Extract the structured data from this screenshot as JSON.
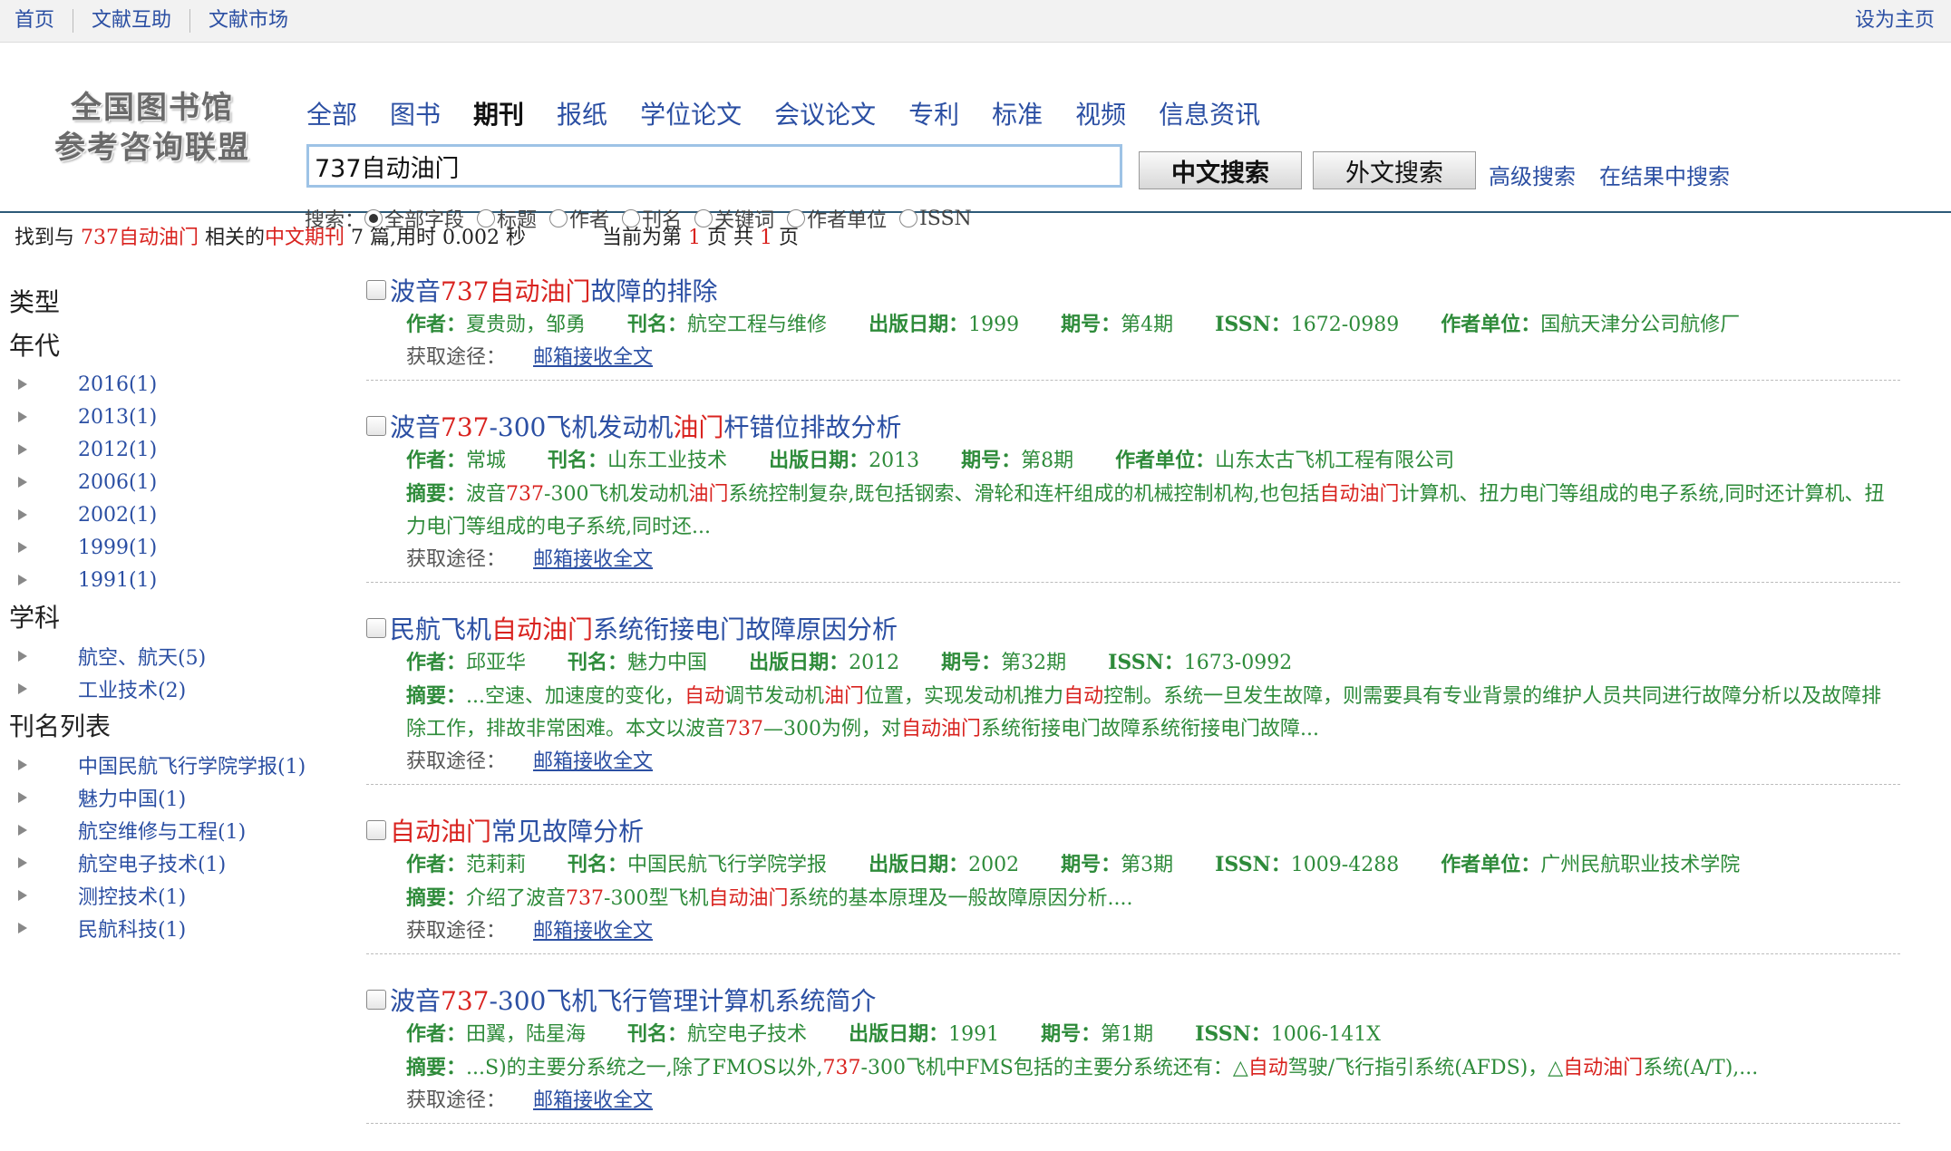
{
  "topbar": {
    "links": [
      "首页",
      "文献互助",
      "文献市场"
    ],
    "right": "设为主页"
  },
  "logo": {
    "line1": "全国图书馆",
    "line2": "参考咨询联盟"
  },
  "categories": [
    {
      "label": "全部",
      "active": false
    },
    {
      "label": "图书",
      "active": false
    },
    {
      "label": "期刊",
      "active": true
    },
    {
      "label": "报纸",
      "active": false
    },
    {
      "label": "学位论文",
      "active": false
    },
    {
      "label": "会议论文",
      "active": false
    },
    {
      "label": "专利",
      "active": false
    },
    {
      "label": "标准",
      "active": false
    },
    {
      "label": "视频",
      "active": false
    },
    {
      "label": "信息资讯",
      "active": false
    }
  ],
  "search": {
    "value": "737自动油门",
    "cn_button": "中文搜索",
    "foreign_button": "外文搜索",
    "advanced": "高级搜索",
    "within": "在结果中搜索"
  },
  "scope": {
    "label": "搜索：",
    "options": [
      "全部字段",
      "标题",
      "作者",
      "刊名",
      "关键词",
      "作者单位",
      "ISSN"
    ],
    "selected": 0
  },
  "summary": {
    "p1": "找到与 ",
    "keyword": "737自动油门",
    "p2": " 相关的",
    "type": "中文期刊",
    "p3": " 7 篇,用时 0.002 秒",
    "p4": "当前为第 ",
    "cur": "1",
    "p5": " 页 共 ",
    "total": "1",
    "p6": " 页"
  },
  "sidebar": {
    "type_heading": "类型",
    "year_heading": "年代",
    "years": [
      "2016(1)",
      "2013(1)",
      "2012(1)",
      "2006(1)",
      "2002(1)",
      "1999(1)",
      "1991(1)"
    ],
    "subject_heading": "学科",
    "subjects": [
      "航空、航天(5)",
      "工业技术(2)"
    ],
    "journal_heading": "刊名列表",
    "journals": [
      "中国民航飞行学院学报(1)",
      "魅力中国(1)",
      "航空维修与工程(1)",
      "航空电子技术(1)",
      "测控技术(1)",
      "民航科技(1)"
    ]
  },
  "labels": {
    "author": "作者：",
    "journal": "刊名：",
    "date": "出版日期：",
    "issue": "期号：",
    "issn": "ISSN：",
    "unit": "作者单位：",
    "abstract": "摘要：",
    "get": "获取途径：",
    "mail": "邮箱接收全文"
  },
  "results": [
    {
      "title": [
        [
          "波音",
          0
        ],
        [
          "737自动油门",
          1
        ],
        [
          "故障的排除",
          0
        ]
      ],
      "author": "夏贵勋，邹勇",
      "journal": "航空工程与维修",
      "date": "1999",
      "issue": "第4期",
      "issn": "1672-0989",
      "unit": "国航天津分公司航修厂",
      "abstract": null
    },
    {
      "title": [
        [
          "波音",
          0
        ],
        [
          "737",
          1
        ],
        [
          "-300飞机发动机",
          0
        ],
        [
          "油门",
          1
        ],
        [
          "杆错位排故分析",
          0
        ]
      ],
      "author": "常城",
      "journal": "山东工业技术",
      "date": "2013",
      "issue": "第8期",
      "issn": null,
      "unit": "山东太古飞机工程有限公司",
      "abstract": [
        [
          "波音",
          0
        ],
        [
          "737",
          1
        ],
        [
          "-300飞机发动机",
          0
        ],
        [
          "油门",
          1
        ],
        [
          "系统控制复杂,既包括钢索、滑轮和连杆组成的机械控制机构,也包括",
          0
        ],
        [
          "自动油门",
          1
        ],
        [
          "计算机、扭力电门等组成的电子系统,同时还计算机、扭力电门等组成的电子系统,同时还...",
          0
        ]
      ]
    },
    {
      "title": [
        [
          "民航飞机",
          0
        ],
        [
          "自动油门",
          1
        ],
        [
          "系统衔接电门故障原因分析",
          0
        ]
      ],
      "author": "邱亚华",
      "journal": "魅力中国",
      "date": "2012",
      "issue": "第32期",
      "issn": "1673-0992",
      "unit": null,
      "abstract": [
        [
          "...空速、加速度的变化，",
          0
        ],
        [
          "自动",
          1
        ],
        [
          "调节发动机",
          0
        ],
        [
          "油门",
          1
        ],
        [
          "位置，实现发动机推力",
          0
        ],
        [
          "自动",
          1
        ],
        [
          "控制。系统一旦发生故障，则需要具有专业背景的维护人员共同进行故障分析以及故障排除工作，排故非常困难。本文以波音",
          0
        ],
        [
          "737",
          1
        ],
        [
          "—300为例，对",
          0
        ],
        [
          "自动油门",
          1
        ],
        [
          "系统衔接电门故障系统衔接电门故障...",
          0
        ]
      ]
    },
    {
      "title": [
        [
          "自动油门",
          1
        ],
        [
          "常见故障分析",
          0
        ]
      ],
      "author": "范莉莉",
      "journal": "中国民航飞行学院学报",
      "date": "2002",
      "issue": "第3期",
      "issn": "1009-4288",
      "unit": "广州民航职业技术学院",
      "abstract": [
        [
          "介绍了波音",
          0
        ],
        [
          "737",
          1
        ],
        [
          "-300型飞机",
          0
        ],
        [
          "自动油门",
          1
        ],
        [
          "系统的基本原理及一般故障原因分析....",
          0
        ]
      ]
    },
    {
      "title": [
        [
          "波音",
          0
        ],
        [
          "737",
          1
        ],
        [
          "-300飞机飞行管理计算机系统简介",
          0
        ]
      ],
      "author": "田翼，陆星海",
      "journal": "航空电子技术",
      "date": "1991",
      "issue": "第1期",
      "issn": "1006-141X",
      "unit": null,
      "abstract": [
        [
          "...S)的主要分系统之一,除了FMOS以外,",
          0
        ],
        [
          "737",
          1
        ],
        [
          "-300飞机中FMS包括的主要分系统还有：△",
          0
        ],
        [
          "自动",
          1
        ],
        [
          "驾驶/飞行指引系统(AFDS)，△",
          0
        ],
        [
          "自动油门",
          1
        ],
        [
          "系统(A/T),...",
          0
        ]
      ]
    }
  ]
}
